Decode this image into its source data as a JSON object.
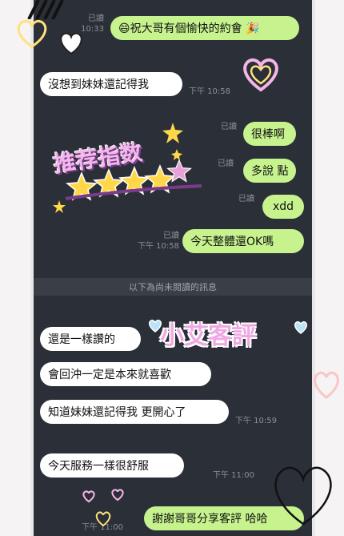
{
  "messages": [
    {
      "text": "😄祝大哥有個愉快的約會 🎉",
      "side": "out",
      "status": "已讀",
      "time": "10:33"
    },
    {
      "text": "沒想到妹妹還記得我",
      "side": "in",
      "time": "下午 10:58"
    },
    {
      "text": "很棒啊",
      "side": "out",
      "status": "已讀"
    },
    {
      "text": "多說 點",
      "side": "out",
      "status": "已讀"
    },
    {
      "text": "xdd",
      "side": "out",
      "status": "已讀"
    },
    {
      "text": "今天整體還OK嗎",
      "side": "out",
      "status": "已讀",
      "time": "下午 10:58"
    },
    {
      "text": "還是一樣讚的",
      "side": "in"
    },
    {
      "text": "會回沖一定是本來就喜歡",
      "side": "in"
    },
    {
      "text": "知道妹妹還記得我 更開心了",
      "side": "in",
      "time": "下午 10:59"
    },
    {
      "text": "今天服務一樣很舒服",
      "side": "in",
      "time": "下午 11:00"
    },
    {
      "text": "謝謝哥哥分享客評 哈哈",
      "side": "out",
      "time": "下午 11:00"
    }
  ],
  "divider": "以下為尚未閱讀的訊息",
  "stickers": {
    "recommend": "推荐指数",
    "brand": "小艾客評"
  },
  "colors": {
    "chat_bg": "#2b2f37",
    "outgoing_bubble": "#c7f38e",
    "incoming_bubble": "#ffffff",
    "accent_pink": "#e8a0d8",
    "star_yellow": "#ffd84a"
  },
  "icons": [
    "heart-outline-icon",
    "heart-glow-icon",
    "star-icon",
    "sparkle-icon"
  ]
}
